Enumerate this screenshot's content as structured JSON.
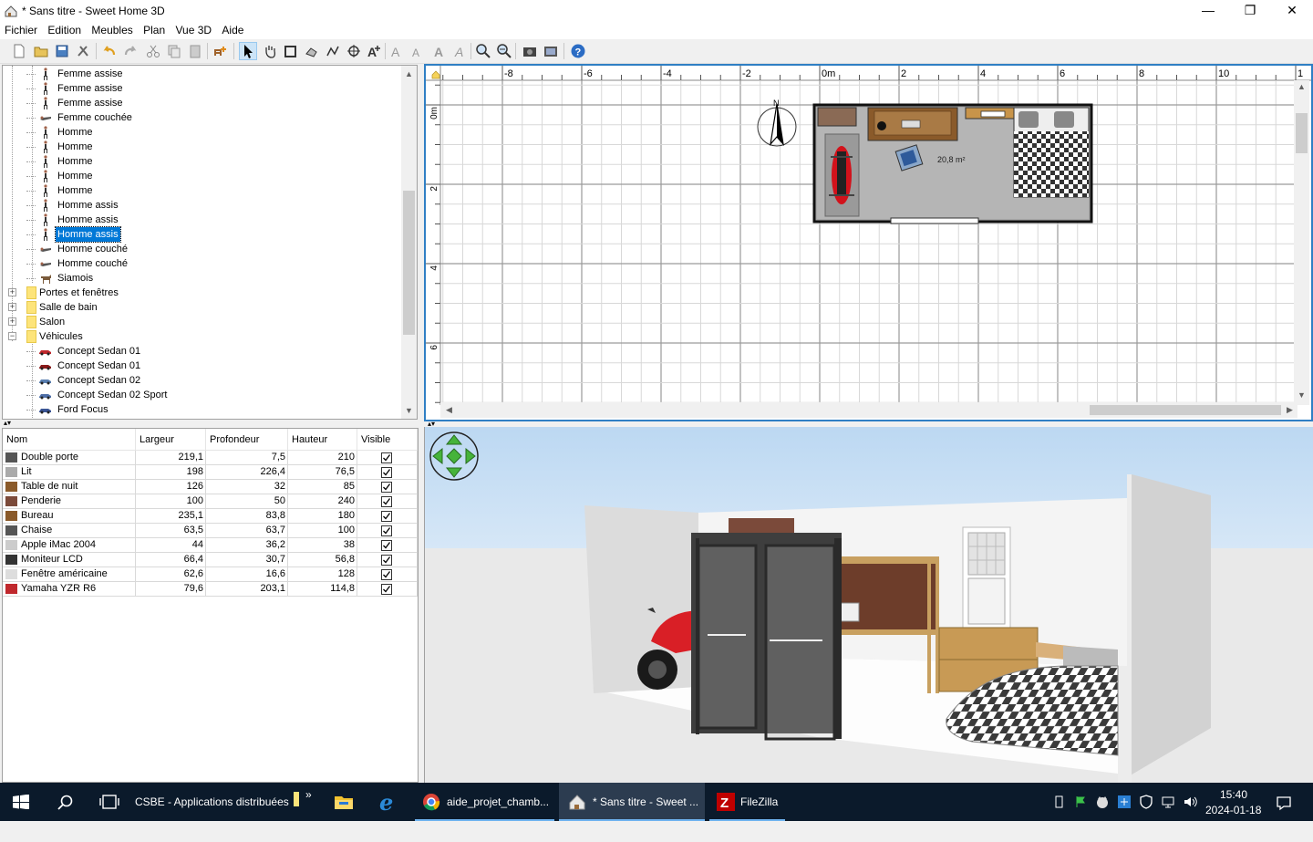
{
  "window": {
    "title": "* Sans titre - Sweet Home 3D",
    "minimize": "—",
    "maximize": "❐",
    "close": "✕"
  },
  "menu": [
    "Fichier",
    "Edition",
    "Meubles",
    "Plan",
    "Vue 3D",
    "Aide"
  ],
  "catalog": {
    "items": [
      {
        "label": "Femme assise"
      },
      {
        "label": "Femme assise"
      },
      {
        "label": "Femme assise"
      },
      {
        "label": "Femme couchée"
      },
      {
        "label": "Homme"
      },
      {
        "label": "Homme"
      },
      {
        "label": "Homme"
      },
      {
        "label": "Homme"
      },
      {
        "label": "Homme"
      },
      {
        "label": "Homme assis"
      },
      {
        "label": "Homme assis"
      },
      {
        "label": "Homme assis",
        "selected": true
      },
      {
        "label": "Homme couché"
      },
      {
        "label": "Homme couché"
      },
      {
        "label": "Siamois"
      }
    ],
    "folders": [
      {
        "label": "Portes et fenêtres",
        "expanded": false
      },
      {
        "label": "Salle de bain",
        "expanded": false
      },
      {
        "label": "Salon",
        "expanded": false
      },
      {
        "label": "Véhicules",
        "expanded": true
      }
    ],
    "vehicles": [
      {
        "label": "Concept Sedan 01",
        "color": "#c0282d"
      },
      {
        "label": "Concept Sedan 01",
        "color": "#8a1a1a"
      },
      {
        "label": "Concept Sedan 02",
        "color": "#5a7fb0"
      },
      {
        "label": "Concept Sedan 02 Sport",
        "color": "#4f6fa8"
      },
      {
        "label": "Ford Focus",
        "color": "#3b5595"
      }
    ]
  },
  "furniture": {
    "columns": [
      "Nom",
      "Largeur",
      "Profondeur",
      "Hauteur",
      "Visible"
    ],
    "rows": [
      {
        "name": "Double porte",
        "width": "219,1",
        "depth": "7,5",
        "height": "210",
        "visible": true
      },
      {
        "name": "Lit",
        "width": "198",
        "depth": "226,4",
        "height": "76,5",
        "visible": true
      },
      {
        "name": "Table de nuit",
        "width": "126",
        "depth": "32",
        "height": "85",
        "visible": true
      },
      {
        "name": "Penderie",
        "width": "100",
        "depth": "50",
        "height": "240",
        "visible": true
      },
      {
        "name": "Bureau",
        "width": "235,1",
        "depth": "83,8",
        "height": "180",
        "visible": true
      },
      {
        "name": "Chaise",
        "width": "63,5",
        "depth": "63,7",
        "height": "100",
        "visible": true
      },
      {
        "name": "Apple iMac 2004",
        "width": "44",
        "depth": "36,2",
        "height": "38",
        "visible": true
      },
      {
        "name": "Moniteur LCD",
        "width": "66,4",
        "depth": "30,7",
        "height": "56,8",
        "visible": true
      },
      {
        "name": "Fenêtre américaine",
        "width": "62,6",
        "depth": "16,6",
        "height": "128",
        "visible": true
      },
      {
        "name": "Yamaha YZR R6",
        "width": "79,6",
        "depth": "203,1",
        "height": "114,8",
        "visible": true
      }
    ]
  },
  "plan": {
    "x_ticks": [
      "-8",
      "-6",
      "-4",
      "-2",
      "0m",
      "2",
      "4",
      "6",
      "8",
      "10",
      "1"
    ],
    "y_ticks": [
      "0m",
      "2",
      "4",
      "6"
    ],
    "room_area": "20,8 m²",
    "compass_label": "N"
  },
  "taskbar": {
    "items": [
      {
        "label": "CSBE - Applications distribuées"
      },
      {
        "label": "aide_projet_chamb..."
      },
      {
        "label": "* Sans titre - Sweet ..."
      },
      {
        "label": "FileZilla"
      }
    ],
    "overflow": "»",
    "time": "15:40",
    "date": "2024-01-18"
  }
}
